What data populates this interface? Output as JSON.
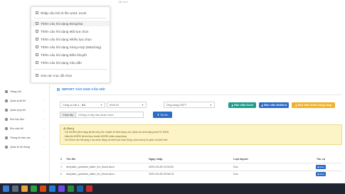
{
  "dropdown": {
    "trigger_label": "Tác vụ",
    "items": [
      {
        "label": "Nhập câu hỏi từ file word, excel",
        "icon": "doc-icon"
      },
      {
        "label": "Thêm câu hỏi dạng Đúng/Sai",
        "icon": "list-icon"
      },
      {
        "label": "Thêm câu hỏi dạng Một lựa chọn",
        "icon": "list-icon"
      },
      {
        "label": "Thêm câu hỏi dạng Nhiều lựa chọn",
        "icon": "list-icon"
      },
      {
        "label": "Thêm câu hỏi dạng Xứng-Hợp (Matching)",
        "icon": "list-icon"
      },
      {
        "label": "Thêm câu hỏi dạng Điền khuyết",
        "icon": "list-icon"
      },
      {
        "label": "Thêm câu hỏi dạng Câu dẫn",
        "icon": "list-icon"
      },
      {
        "label": "Xóa các mục đã chọn",
        "icon": "trash-icon"
      }
    ]
  },
  "sidebar": {
    "items": [
      {
        "label": "Trang chủ"
      },
      {
        "label": "Quản lý đề thi"
      },
      {
        "label": "Quản lý kỳ thi"
      },
      {
        "label": "Kho học liệu"
      },
      {
        "label": "Kho câu hỏi"
      },
      {
        "label": "Thống kê báo cáo"
      },
      {
        "label": "Quản trị hệ thống"
      }
    ]
  },
  "main": {
    "title": "IMPORT VÀO KHO CÂU HỎI",
    "selects": {
      "subject": "Công cụ bài 4 - Bài",
      "grade": "Khối 10",
      "category": "Ứng dụng CNTT"
    },
    "buttons": {
      "excel_template": "Bản mẫu Excel",
      "word_template": "Bản mẫu MsWord",
      "multi_template": "Bản mẫu nhiều dạng bảng"
    },
    "file": {
      "choose_label": "Chọn tệp",
      "no_file": "Không có tệp nào được chọn"
    },
    "upload_label": "Tải lên",
    "note": {
      "title": "Chú ý",
      "lines": [
        "- Với WORD (định dạng tài liệu đúc) thì chuyển về định dạng .doc (Save As dưới dạng word 97-2003)",
        "- Mẫu file WORD tải lên theo chuẩn WORD nhiều dạng bảng",
        "- Chỉ hỗ trợ câu hỏi dạng 1 lựa chọn đúng và nhiều lựa chọn đúng, chèn các ký tự phức và hình ảnh"
      ]
    },
    "table": {
      "headers": [
        "#",
        "Tên file",
        "Ngày nhập",
        "Loại import",
        "Tác vụ"
      ],
      "rows": [
        {
          "index": "1",
          "file": "template_question_table_for_block.docx",
          "date": "2020-03-28 23:34:02",
          "type": "Doc",
          "action": "Xem"
        },
        {
          "index": "2",
          "file": "template_question_table_for_block.docx",
          "date": "2020-03-28 09:06:13",
          "type": "Doc",
          "action": "Xem"
        }
      ]
    }
  },
  "colors": {
    "accent": "#2b82d9",
    "excel_btn": "#1f9d8a",
    "word_btn": "#2d6cc6",
    "multi_btn": "#f0b22b",
    "note_bg": "#fcf3c6",
    "taskbar": "#1f2430"
  }
}
